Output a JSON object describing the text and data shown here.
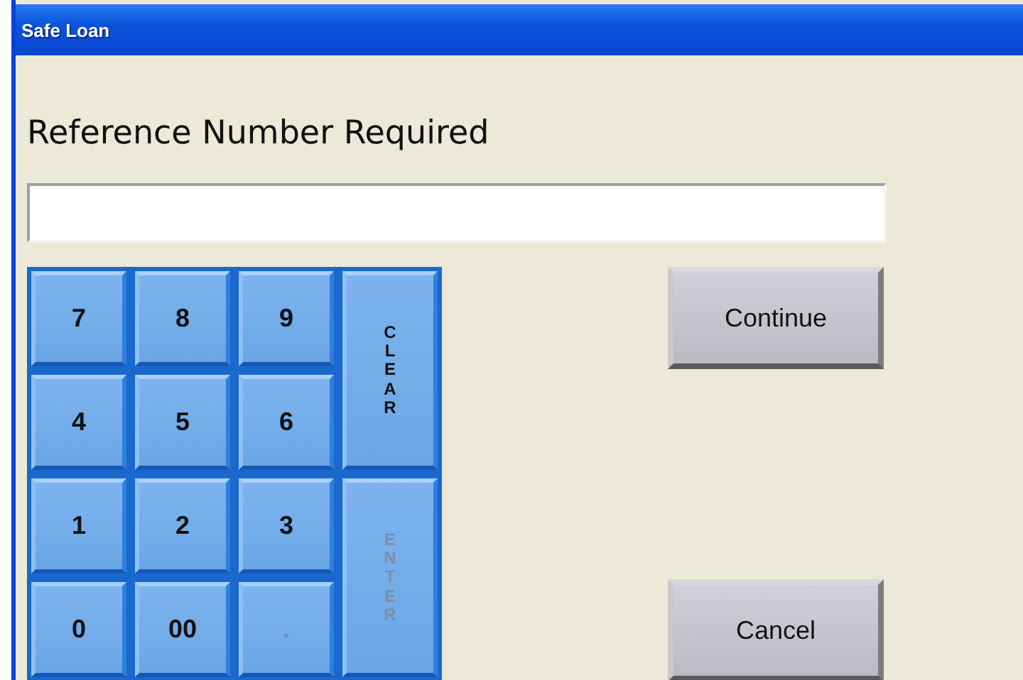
{
  "window": {
    "title": "Safe Loan"
  },
  "prompt": "Reference Number Required",
  "keypad": [
    {
      "label": "7",
      "kind": "key",
      "disabled": false
    },
    {
      "label": "8",
      "kind": "key",
      "disabled": false
    },
    {
      "label": "9",
      "kind": "key",
      "disabled": false
    },
    {
      "label": "CLEAR",
      "kind": "tall",
      "disabled": false
    },
    {
      "label": "4",
      "kind": "key",
      "disabled": false
    },
    {
      "label": "5",
      "kind": "key",
      "disabled": false
    },
    {
      "label": "6",
      "kind": "key",
      "disabled": false
    },
    {
      "label": "1",
      "kind": "key",
      "disabled": false
    },
    {
      "label": "2",
      "kind": "key",
      "disabled": false
    },
    {
      "label": "3",
      "kind": "key",
      "disabled": false
    },
    {
      "label": "ENTER",
      "kind": "tall",
      "disabled": true
    },
    {
      "label": "0",
      "kind": "key",
      "disabled": false
    },
    {
      "label": "00",
      "kind": "key",
      "disabled": false
    },
    {
      "label": ".",
      "kind": "key",
      "disabled": true
    }
  ],
  "buttons": [
    "Continue",
    "Cancel"
  ]
}
